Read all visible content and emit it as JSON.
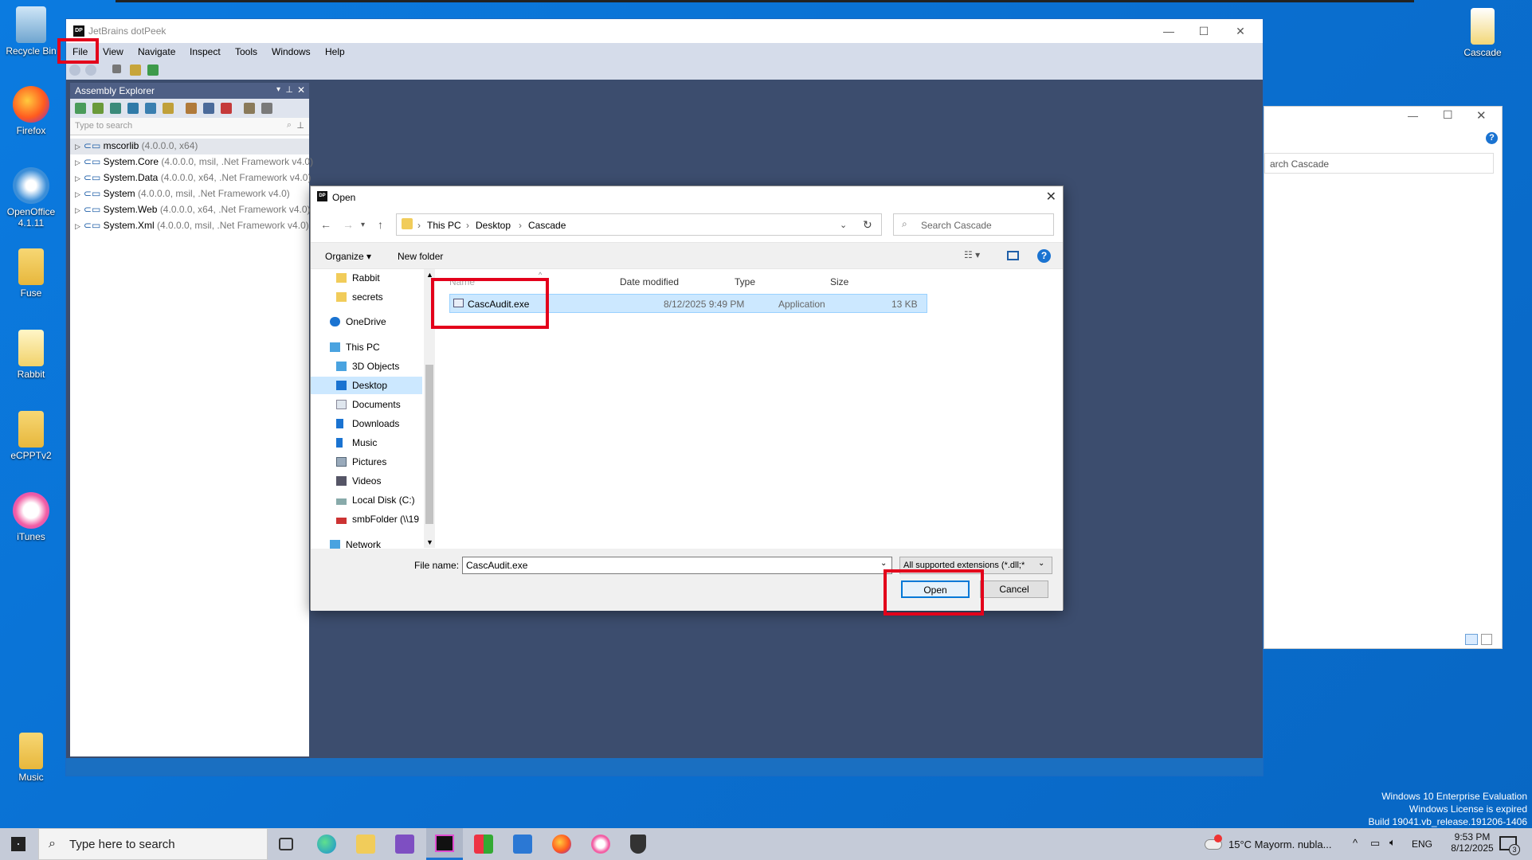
{
  "desktop": {
    "icons": [
      {
        "name": "recycle-bin",
        "label": "Recycle Bin"
      },
      {
        "name": "firefox",
        "label": "Firefox"
      },
      {
        "name": "openoffice",
        "label": "OpenOffice 4.1.11"
      },
      {
        "name": "fuse",
        "label": "Fuse"
      },
      {
        "name": "rabbit",
        "label": "Rabbit"
      },
      {
        "name": "ecpptv2",
        "label": "eCPPTv2"
      },
      {
        "name": "itunes",
        "label": "iTunes"
      },
      {
        "name": "music",
        "label": "Music"
      },
      {
        "name": "cascade",
        "label": "Cascade"
      }
    ]
  },
  "dotpeek": {
    "title": "JetBrains dotPeek",
    "logo": "DP",
    "menu": [
      "File",
      "View",
      "Navigate",
      "Inspect",
      "Tools",
      "Windows",
      "Help"
    ],
    "explorer": {
      "title": "Assembly Explorer",
      "search_placeholder": "Type to search",
      "items": [
        {
          "name": "mscorlib",
          "meta": "(4.0.0.0, x64)"
        },
        {
          "name": "System.Core",
          "meta": "(4.0.0.0, msil, .Net Framework v4.0)"
        },
        {
          "name": "System.Data",
          "meta": "(4.0.0.0, x64, .Net Framework v4.0)"
        },
        {
          "name": "System",
          "meta": "(4.0.0.0, msil, .Net Framework v4.0)"
        },
        {
          "name": "System.Web",
          "meta": "(4.0.0.0, x64, .Net Framework v4.0)"
        },
        {
          "name": "System.Xml",
          "meta": "(4.0.0.0, msil, .Net Framework v4.0)"
        }
      ]
    }
  },
  "right_window": {
    "search_text": "arch Cascade"
  },
  "dialog": {
    "title": "Open",
    "breadcrumb": [
      "This PC",
      "Desktop",
      "Cascade"
    ],
    "search_placeholder": "Search Cascade",
    "organize": "Organize ▾",
    "new_folder": "New folder",
    "nav_items": [
      "Rabbit",
      "secrets",
      "OneDrive",
      "This PC",
      "3D Objects",
      "Desktop",
      "Documents",
      "Downloads",
      "Music",
      "Pictures",
      "Videos",
      "Local Disk (C:)",
      "smbFolder (\\\\19",
      "Network"
    ],
    "columns": [
      "Name",
      "Date modified",
      "Type",
      "Size"
    ],
    "files": [
      {
        "name": "CascAudit.exe",
        "date": "8/12/2025 9:49 PM",
        "type": "Application",
        "size": "13 KB"
      }
    ],
    "filename_label": "File name:",
    "filename_value": "CascAudit.exe",
    "filter": "All supported extensions (*.dll;*",
    "open_label": "Open",
    "cancel_label": "Cancel"
  },
  "taskbar": {
    "search_placeholder": "Type here to search",
    "weather": "15°C  Mayorm. nubla...",
    "lang": "ENG",
    "time": "9:53 PM",
    "date": "8/12/2025",
    "notif": "3"
  },
  "watermark": {
    "line1": "Windows 10 Enterprise Evaluation",
    "line2": "Windows License is expired",
    "line3": "Build 19041.vb_release.191206-1406"
  }
}
